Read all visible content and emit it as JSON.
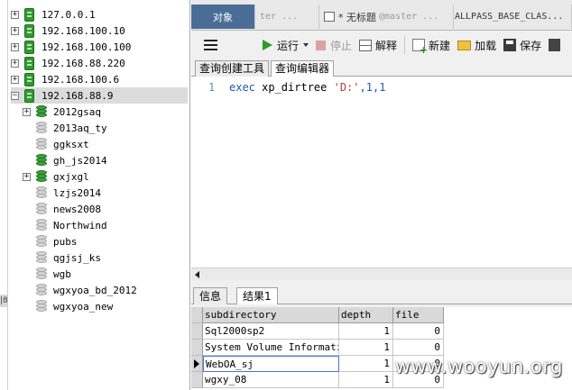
{
  "left_strip": {
    "mark": "|8"
  },
  "tree": {
    "servers": [
      {
        "label": "127.0.0.1",
        "expander": "+"
      },
      {
        "label": "192.168.100.10",
        "expander": "+"
      },
      {
        "label": "192.168.100.100",
        "expander": "+"
      },
      {
        "label": "192.168.88.220",
        "expander": "+"
      },
      {
        "label": "192.168.100.6",
        "expander": "+"
      },
      {
        "label": "192.168.88.9",
        "expander": "−"
      }
    ],
    "databases": [
      {
        "label": "2012gsaq",
        "expander": "+",
        "active": true
      },
      {
        "label": "2013aq_ty",
        "expander": "",
        "active": false
      },
      {
        "label": "ggksxt",
        "expander": "",
        "active": false
      },
      {
        "label": "gh_js2014",
        "expander": "",
        "active": true
      },
      {
        "label": "gxjxgl",
        "expander": "+",
        "active": true
      },
      {
        "label": "lzjs2014",
        "expander": "",
        "active": false
      },
      {
        "label": "news2008",
        "expander": "",
        "active": false
      },
      {
        "label": "Northwind",
        "expander": "",
        "active": false
      },
      {
        "label": "pubs",
        "expander": "",
        "active": false
      },
      {
        "label": "qgjsj_ks",
        "expander": "",
        "active": false
      },
      {
        "label": "wgb",
        "expander": "",
        "active": false
      },
      {
        "label": "wgxyoa_bd_2012",
        "expander": "",
        "active": false
      },
      {
        "label": "wgxyoa_new",
        "expander": "",
        "active": false
      }
    ]
  },
  "doc_tabs": {
    "objects": "对象",
    "tab2": "ter ...",
    "tab3_prefix": "* 无标题",
    "tab3_suffix": "@master ...",
    "tab4": "ALLPASS_BASE_CLAS..."
  },
  "toolbar": {
    "run": "运行",
    "stop": "停止",
    "explain": "解释",
    "new": "新建",
    "load": "加载",
    "save": "保存"
  },
  "sub_tabs": {
    "builder": "查询创建工具",
    "editor": "查询编辑器"
  },
  "editor": {
    "line_number": "1",
    "keyword": "exec",
    "proc": " xp_dirtree ",
    "string_arg": "'D:'",
    "rest": ",1,1"
  },
  "result_tabs": {
    "info": "信息",
    "result1": "结果1"
  },
  "grid": {
    "columns": [
      "subdirectory",
      "depth",
      "file"
    ],
    "rows": [
      [
        "Sql2000sp2",
        "1",
        "0"
      ],
      [
        "System Volume Information",
        "1",
        "0"
      ],
      [
        "WebOA_sj",
        "1",
        "0"
      ],
      [
        "wgxy_08",
        "1",
        "0"
      ]
    ],
    "current_row": 2
  },
  "watermark": "www.wooyun.org",
  "colors": {
    "accent_tab": "#4a6d96",
    "run_green": "#2c9b2c",
    "server_green": "#2f9b2f"
  }
}
